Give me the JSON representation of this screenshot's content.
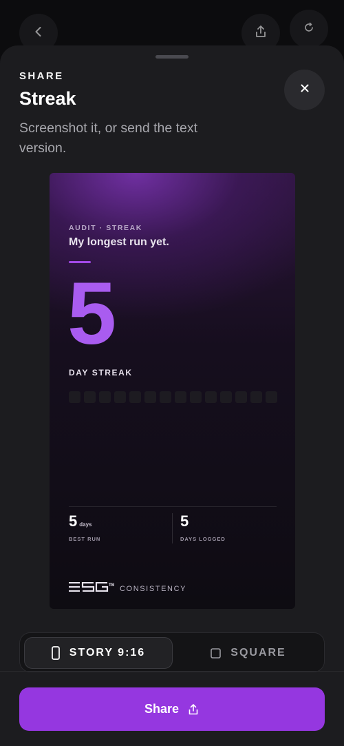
{
  "background_nav": {
    "back_icon": "chevron-left-icon",
    "share_icon": "share-icon",
    "refresh_icon": "refresh-icon"
  },
  "sheet": {
    "eyebrow": "SHARE",
    "title": "Streak",
    "subtitle": "Screenshot it, or send the text version.",
    "close_icon": "close-icon"
  },
  "card": {
    "eyebrow": "AUDIT · STREAK",
    "tagline": "My longest run yet.",
    "big_number": "5",
    "label": "DAY STREAK",
    "grid": {
      "columns": 14,
      "rows": 7,
      "active_days": [
        {
          "column": 13,
          "row": 0,
          "state": "on"
        },
        {
          "column": 13,
          "row": 1,
          "state": "on"
        },
        {
          "column": 13,
          "row": 2,
          "state": "on"
        },
        {
          "column": 13,
          "row": 3,
          "state": "on"
        },
        {
          "column": 12,
          "row": 6,
          "state": "dim"
        }
      ]
    },
    "stats": [
      {
        "value": "5",
        "unit": "days",
        "caption": "BEST RUN"
      },
      {
        "value": "5",
        "unit": "",
        "caption": "DAYS LOGGED"
      }
    ],
    "brand": {
      "logo": "ESG™",
      "name": "CONSISTENCY"
    }
  },
  "format_toggle": {
    "options": [
      {
        "label": "STORY 9:16",
        "icon": "phone-icon",
        "selected": true
      },
      {
        "label": "SQUARE",
        "icon": "square-icon",
        "selected": false
      }
    ]
  },
  "share_button": {
    "label": "Share",
    "icon": "share-icon"
  },
  "colors": {
    "accent": "#9537e0",
    "accent_bright": "#a95cf0",
    "sheet_bg": "#1c1c1f"
  }
}
